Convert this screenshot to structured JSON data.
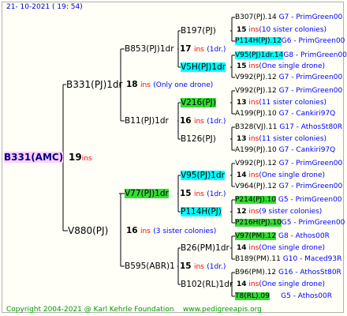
{
  "header": {
    "date_text": "21- 10-2021 ( 19: 54)"
  },
  "root": {
    "name": "B331(AMC)",
    "year": "19",
    "unit": "ins"
  },
  "gen1": {
    "top": {
      "name": "B331(PJ)1dr",
      "year": "18",
      "unit": "ins",
      "note": "(Only one drone)"
    },
    "bottom": {
      "name": "V880(PJ)",
      "year": "16",
      "unit": "ins",
      "note": "(3 sister colonies)"
    }
  },
  "gen2": [
    {
      "name": "B853(PJ)1dr",
      "year": "17",
      "unit": "ins",
      "note": "(1dr.)"
    },
    {
      "name": "B11(PJ)1dr",
      "year": "16",
      "unit": "ins",
      "note": "(1dr.)"
    },
    {
      "name": "V77(PJ)1dr",
      "year": "15",
      "unit": "ins",
      "note": "(1dr.)"
    },
    {
      "name": "B595(ABR)1",
      "year": "15",
      "unit": "ins",
      "note": "(1dr.)"
    }
  ],
  "gen3": [
    {
      "name": "B197(PJ)",
      "year": "15",
      "unit": "ins",
      "note": "(1dr.)"
    },
    {
      "name": "V5H(PJ)1dr",
      "year": "15",
      "unit": "ins",
      "note": "(One single drone)"
    },
    {
      "name": "V216(PJ)",
      "year": "13",
      "unit": "ins",
      "note": "(11 sister colonies)"
    },
    {
      "name": "B126(PJ)",
      "year": "13",
      "unit": "ins",
      "note": "(11 sister colonies)"
    },
    {
      "name": "V95(PJ)1dr",
      "year": "14",
      "unit": "ins",
      "note": "(One single drone)"
    },
    {
      "name": "P114H(PJ)",
      "year": "12",
      "unit": "ins",
      "note": "(9 sister colonies)"
    },
    {
      "name": "B26(PM)1dr",
      "year": "14",
      "unit": "ins",
      "note": "(One single drone)"
    },
    {
      "name": "B102(RL)1dr",
      "year": "14",
      "unit": "ins",
      "note": "(One single drone)"
    }
  ],
  "gen4": [
    {
      "name": "B307(PJ).14",
      "code": "G7 - PrimGreen00"
    },
    {
      "name": "P114H(PJ).12",
      "code": "G6 - PrimGreen00"
    },
    {
      "name": "V95(PJ)1dr.14",
      "code": "G8 - PrimGreen00"
    },
    {
      "name": "V992(PJ).12",
      "code": "G7 - PrimGreen00"
    },
    {
      "name": "V992(PJ).12",
      "code": "G7 - PrimGreen00"
    },
    {
      "name": "A199(PJ).10",
      "code": "G7 - Cankiri97Q"
    },
    {
      "name": "B328(VJ).11",
      "code": "G17 - AthosSt80R"
    },
    {
      "name": "A199(PJ).10",
      "code": "G7 - Cankiri97Q"
    },
    {
      "name": "V992(PJ).12",
      "code": "G7 - PrimGreen00"
    },
    {
      "name": "V964(PJ).12",
      "code": "G7 - PrimGreen00"
    },
    {
      "name": "P214(PJ).10",
      "code": "G5 - PrimGreen00"
    },
    {
      "name": "P216H(PJ).10",
      "code": "G5 - PrimGreen00"
    },
    {
      "name": "V97(PM).12",
      "code": "G8 - Athos00R"
    },
    {
      "name": "B189(PM).11",
      "code": "G10 - Maced93R"
    },
    {
      "name": "B96(PM).12",
      "code": "G16 - AthosSt80R"
    },
    {
      "name": "T8(RL).09",
      "code": "G5 - Athos00R"
    }
  ],
  "gen4_notes": [
    {
      "year": "15",
      "unit": "ins",
      "note": "(10 sister colonies)"
    },
    {
      "year": "15",
      "unit": "ins",
      "note": "(One single drone)"
    },
    {
      "year": "13",
      "unit": "ins",
      "note": "(11 sister colonies)"
    },
    {
      "year": "13",
      "unit": "ins",
      "note": "(11 sister colonies)"
    },
    {
      "year": "14",
      "unit": "ins",
      "note": "(One single drone)"
    },
    {
      "year": "12",
      "unit": "ins",
      "note": "(9 sister colonies)"
    },
    {
      "year": "14",
      "unit": "ins",
      "note": "(One single drone)"
    },
    {
      "year": "14",
      "unit": "ins",
      "note": "(One single drone)"
    }
  ],
  "footer": {
    "copyright": "Copyright 2004-2021 @ Karl Kehrle Foundation",
    "url": "www.pedigreeapis.org"
  }
}
